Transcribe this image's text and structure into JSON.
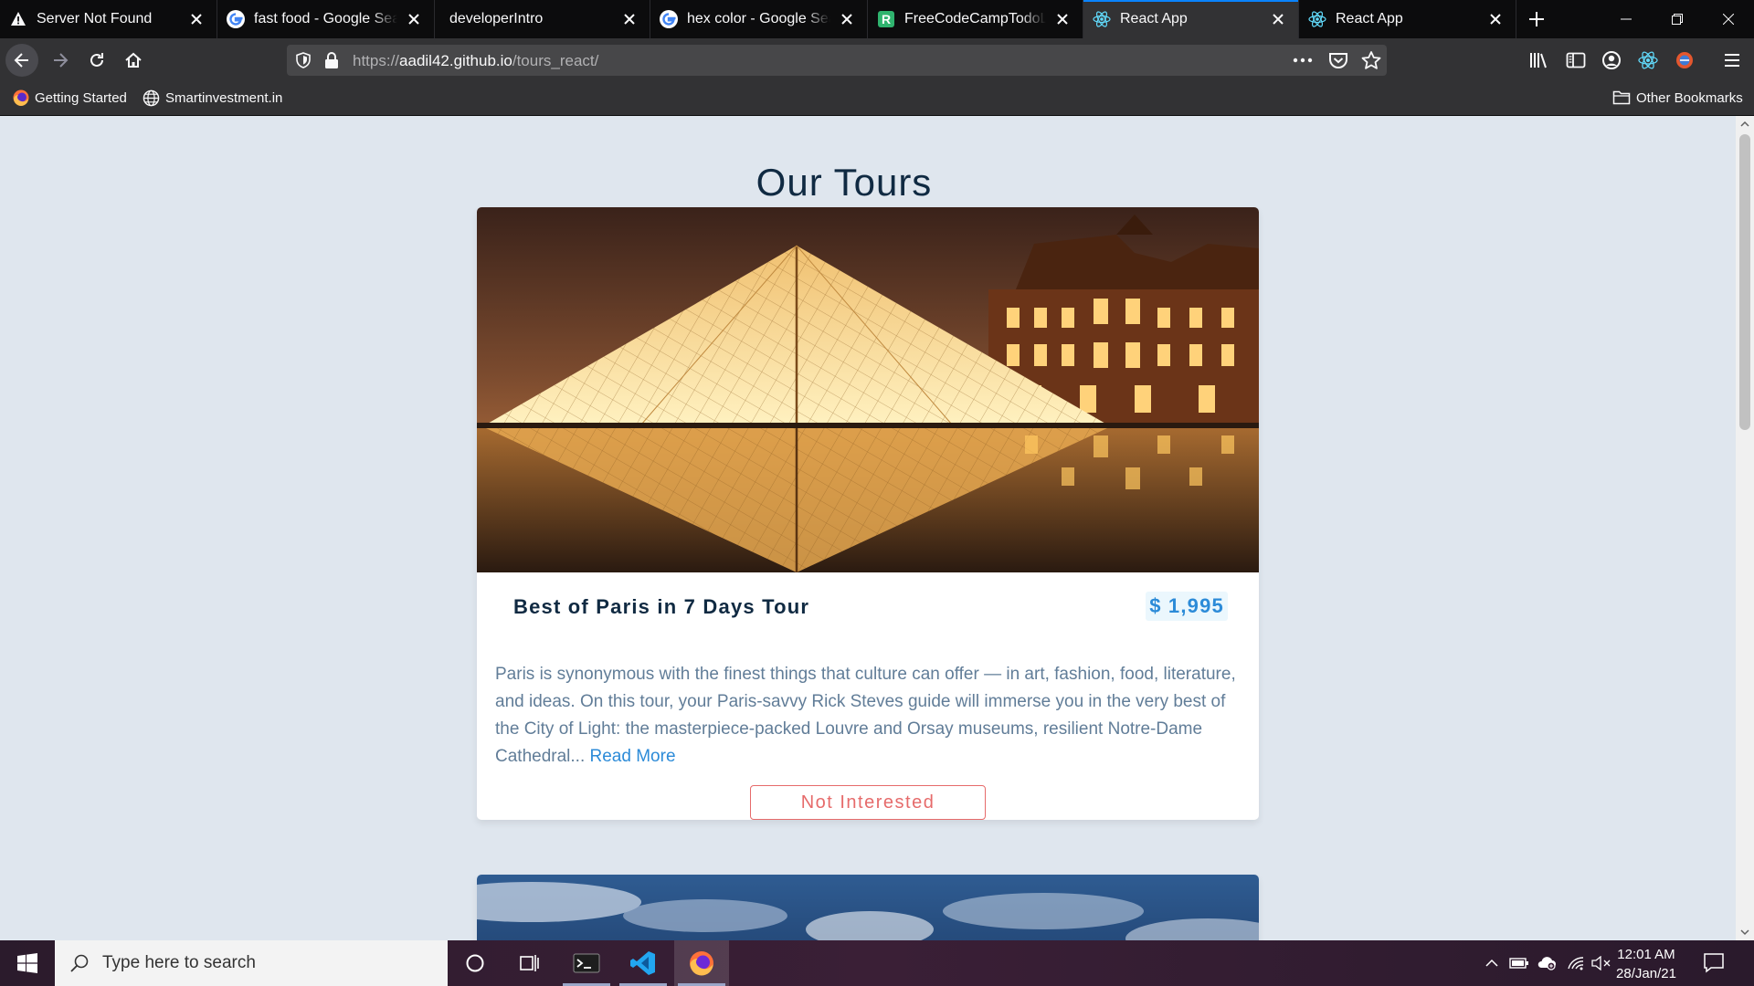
{
  "browser": {
    "tabs": [
      {
        "title": "Server Not Found",
        "icon": "warning-icon",
        "active": false
      },
      {
        "title": "fast food - Google Search",
        "icon": "google-icon",
        "active": false
      },
      {
        "title": "developerIntro",
        "icon": "none",
        "active": false
      },
      {
        "title": "hex color - Google Search",
        "icon": "google-icon",
        "active": false
      },
      {
        "title": "FreeCodeCampTodoList",
        "icon": "replit-icon",
        "active": false
      },
      {
        "title": "React App",
        "icon": "react-icon",
        "active": true
      },
      {
        "title": "React App",
        "icon": "react-icon",
        "active": false
      }
    ],
    "url": {
      "scheme": "https://",
      "host": "aadil42.github.io",
      "path": "/tours_react/"
    },
    "bookmarks": [
      {
        "label": "Getting Started",
        "icon": "firefox-icon"
      },
      {
        "label": "Smartinvestment.in",
        "icon": "globe-icon"
      }
    ],
    "other_bookmarks": "Other Bookmarks"
  },
  "page": {
    "heading": "Our Tours",
    "tour": {
      "name": "Best of Paris in 7 Days Tour",
      "price": "$ 1,995",
      "info": "Paris is synonymous with the finest things that culture can offer — in art, fashion, food, literature, and ideas. On this tour, your Paris-savvy Rick Steves guide will immerse you in the very best of the City of Light: the masterpiece-packed Louvre and Orsay museums, resilient Notre-Dame Cathedral...",
      "read_more": "Read More",
      "not_interested": "Not Interested"
    }
  },
  "taskbar": {
    "search_placeholder": "Type here to search",
    "time": "12:01 AM",
    "date": "28/Jan/21",
    "pinned": [
      "terminal-icon",
      "vscode-icon",
      "firefox-icon"
    ]
  },
  "colors": {
    "accent_tab": "#0a84ff",
    "page_bg": "#dfe6ee",
    "heading": "#102a42",
    "price": "#2c8bd8",
    "danger": "#e66b6b"
  }
}
